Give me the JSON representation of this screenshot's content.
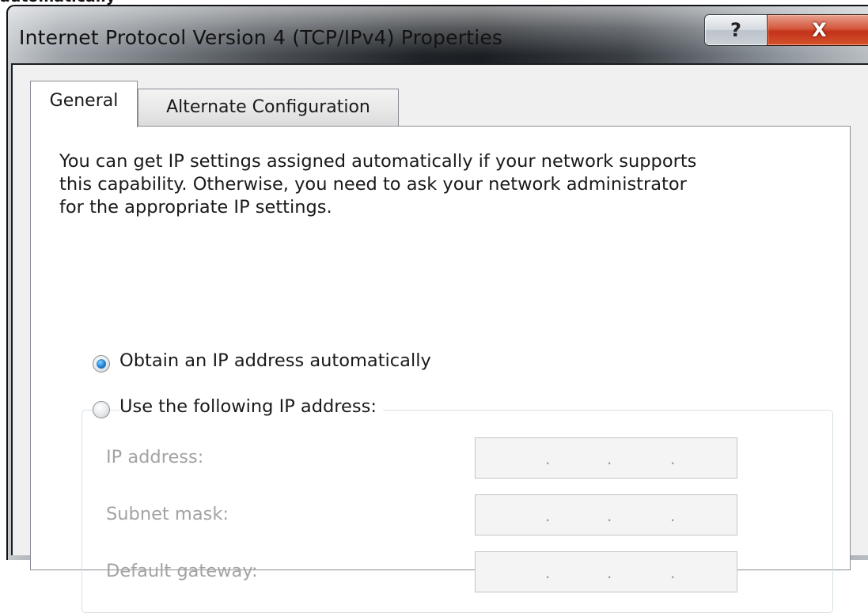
{
  "caption": "automatically",
  "window": {
    "title": "Internet Protocol Version 4 (TCP/IPv4) Properties",
    "help_glyph": "?",
    "close_glyph": "X",
    "help_icon": "help-icon",
    "close_icon": "close-icon"
  },
  "tabs": [
    {
      "label": "General",
      "selected": true
    },
    {
      "label": "Alternate Configuration",
      "selected": false
    }
  ],
  "general": {
    "intro": "You can get IP settings assigned automatically if your network supports\nthis capability. Otherwise, you need to ask your network administrator\nfor the appropriate IP settings.",
    "radio_auto": {
      "label": "Obtain an IP address automatically",
      "checked": true
    },
    "radio_manual": {
      "label": "Use the following IP address:",
      "checked": false
    },
    "fields": [
      {
        "label": "IP address:",
        "value": ""
      },
      {
        "label": "Subnet mask:",
        "value": ""
      },
      {
        "label": "Default gateway:",
        "value": ""
      }
    ],
    "octet_separator": "."
  },
  "colors": {
    "radio_selected": "#1e7fcf",
    "disabled_text": "#a3a3a3",
    "close_button": "#c2321a"
  }
}
